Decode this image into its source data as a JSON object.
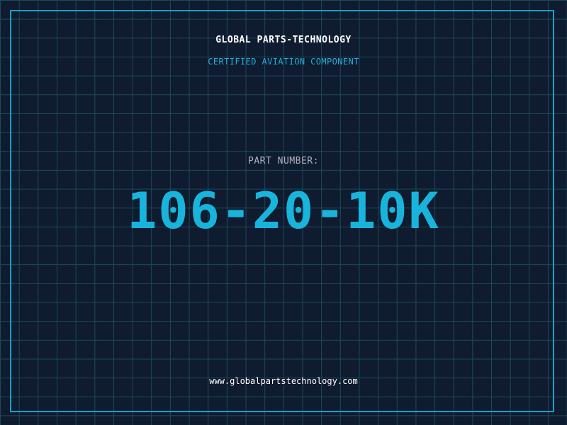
{
  "header": {
    "company": "GLOBAL PARTS-TECHNOLOGY",
    "subtitle": "CERTIFIED AVIATION COMPONENT"
  },
  "part": {
    "label": "PART NUMBER:",
    "number": "106-20-10K"
  },
  "footer": {
    "website": "www.globalpartstechnology.com"
  },
  "colors": {
    "background": "#0f1b2e",
    "grid": "#1d4a5e",
    "accent": "#13a3cc",
    "text_primary": "#ffffff",
    "text_muted": "#aab4c2"
  }
}
